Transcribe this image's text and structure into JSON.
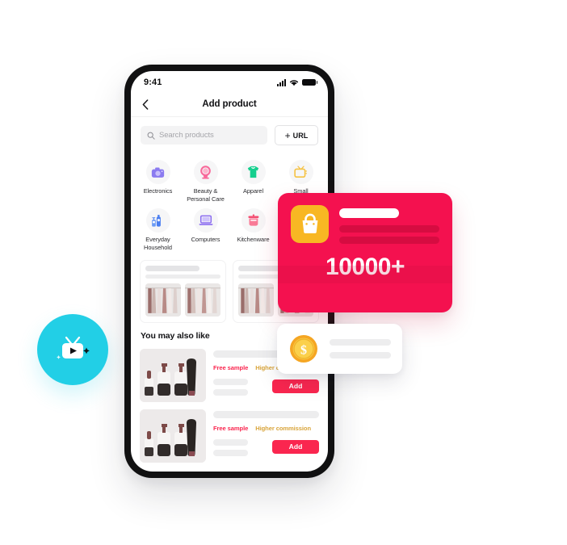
{
  "app": {
    "status_bar": {
      "time": "9:41",
      "signal_icon": "cellular-signal-icon",
      "wifi_icon": "wifi-icon",
      "battery_icon": "battery-icon"
    },
    "nav": {
      "back_icon": "chevron-left-icon",
      "title": "Add product"
    },
    "search": {
      "icon": "search-icon",
      "placeholder": "Search products",
      "value": ""
    },
    "url_button": {
      "plus": "+",
      "label": "URL"
    },
    "categories": [
      {
        "label": "Electronics",
        "icon": "camera-icon",
        "color": "#7b68ee"
      },
      {
        "label": "Beauty &\nPersonal Care",
        "icon": "mirror-icon",
        "color": "#f8699a"
      },
      {
        "label": "Apparel",
        "icon": "tshirt-icon",
        "color": "#15cf8e"
      },
      {
        "label": "Small",
        "icon": "television-icon",
        "color": "#f5c242"
      },
      {
        "label": "Everyday\nHousehold",
        "icon": "bottles-icon",
        "color": "#4a7ef0"
      },
      {
        "label": "Computers",
        "icon": "laptop-icon",
        "color": "#8a6cf0"
      },
      {
        "label": "Kitchenware",
        "icon": "pot-icon",
        "color": "#f44e72"
      }
    ],
    "promo_cards": [
      {
        "image_alt": "clothing-rack",
        "image_alt_2": "clothing-rack"
      },
      {
        "image_alt": "clothing-rack",
        "image_alt_2": "clothing-rack"
      }
    ],
    "section_title": "You may also like",
    "products": [
      {
        "image_alt": "cosmetic-bottles",
        "tag_free": "Free sample",
        "tag_commission": "Higher commission",
        "add_label": "Add"
      },
      {
        "image_alt": "cosmetic-bottles",
        "tag_free": "Free sample",
        "tag_commission": "Higher commission",
        "add_label": "Add"
      }
    ]
  },
  "overlays": {
    "pink_card": {
      "icon": "shopping-bag-icon",
      "count": "10000+",
      "bg_color": "#f4114f",
      "icon_bg": "#f8b723"
    },
    "coin_card": {
      "icon": "dollar-coin-icon"
    },
    "cyan_badge": {
      "icon": "tv-play-icon",
      "bg_color": "#22cfe6"
    }
  }
}
